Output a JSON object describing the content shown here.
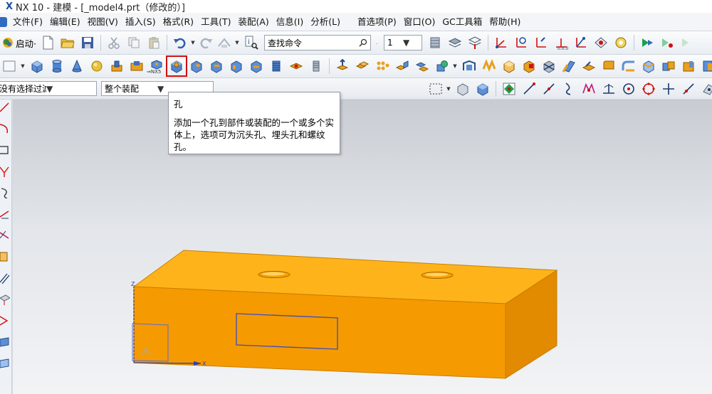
{
  "window": {
    "logo": "X",
    "title": "NX 10 - 建模 - [_model4.prt（修改的）]"
  },
  "menu": {
    "items": [
      "文件(F)",
      "编辑(E)",
      "视图(V)",
      "插入(S)",
      "格式(R)",
      "工具(T)",
      "装配(A)",
      "信息(I)",
      "分析(L)",
      "首选项(P)",
      "窗口(O)",
      "GC工具箱",
      "帮助(H)"
    ]
  },
  "toolbar1": {
    "start_label": "启动·",
    "find_placeholder": "查找命令",
    "layer_value": "1"
  },
  "toolbar2": {
    "nx5_badge": "⇒NX5",
    "highlighted_tool": "hole-icon"
  },
  "toolbar3": {
    "filter_value": "没有选择过滤器",
    "scope_value": "整个装配"
  },
  "tooltip": {
    "title": "孔",
    "body": "添加一个孔到部件或装配的一个或多个实体上，选项可为沉头孔、埋头孔和螺纹孔。"
  },
  "viewport": {
    "model_color": "#f5a000",
    "axis_labels": {
      "x": "X",
      "z": "Z"
    }
  },
  "colors": {
    "accent": "#d01010",
    "model_top": "#ffb31a",
    "model_front": "#f59a00",
    "model_side": "#e08a00",
    "sketch_line": "#3a4ec0"
  }
}
